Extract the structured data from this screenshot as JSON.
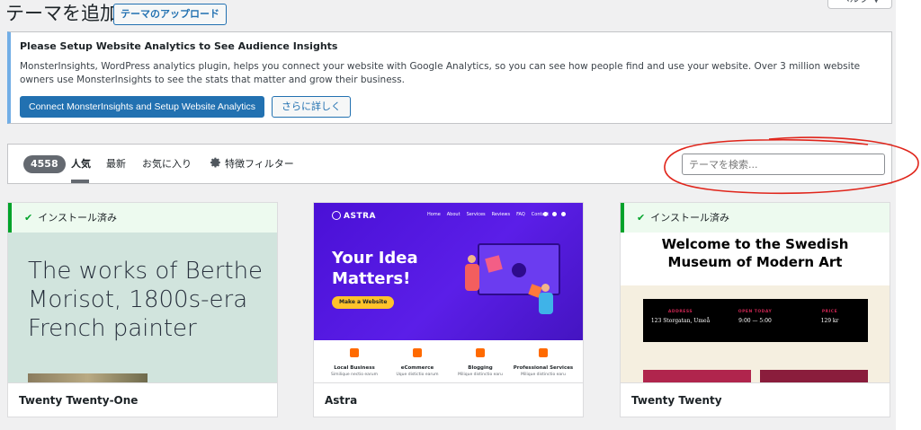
{
  "header": {
    "title": "テーマを追加",
    "upload_label": "テーマのアップロード",
    "help_label": "ヘルプ ▼"
  },
  "notice": {
    "title": "Please Setup Website Analytics to See Audience Insights",
    "body": "MonsterInsights, WordPress analytics plugin, helps you connect your website with Google Analytics, so you can see how people find and use your website. Over 3 million website owners use MonsterInsights to see the stats that matter and grow their business.",
    "primary_label": "Connect MonsterInsights and Setup Website Analytics",
    "secondary_label": "さらに詳しく"
  },
  "filter": {
    "count": "4558",
    "tabs": [
      "人気",
      "最新",
      "お気に入り"
    ],
    "feature_filter_label": "特徴フィルター",
    "search_placeholder": "テーマを検索..."
  },
  "themes": [
    {
      "name": "Twenty Twenty-One",
      "installed_label": "インストール済み",
      "preview_text": "The works of Berthe Morisot, 1800s-era French painter"
    },
    {
      "name": "Astra",
      "preview": {
        "logo": "ASTRA",
        "nav": [
          "Home",
          "About",
          "Services",
          "Reviews",
          "FAQ",
          "Contact"
        ],
        "headline_1": "Your Idea",
        "headline_2": "Matters!",
        "cta": "Make a Website",
        "services": [
          {
            "label": "Local Business",
            "sub": "Similique nectio earum"
          },
          {
            "label": "eCommerce",
            "sub": "Uque distictio earum"
          },
          {
            "label": "Blogging",
            "sub": "Milique distinctio earu"
          },
          {
            "label": "Professional Services",
            "sub": "Milique distinctio earu"
          }
        ]
      }
    },
    {
      "name": "Twenty Twenty",
      "installed_label": "インストール済み",
      "preview": {
        "headline_1": "Welcome to the Swedish",
        "headline_2": "Museum of Modern Art",
        "info": [
          {
            "k": "ADDRESS",
            "v": "123 Storgatan, Umeå"
          },
          {
            "k": "OPEN TODAY",
            "v": "9:00 — 5:00"
          },
          {
            "k": "PRICE",
            "v": "129 kr"
          }
        ]
      }
    }
  ],
  "colors": {
    "accent": "#2271b1",
    "installed_green": "#00a32a",
    "annotation_red": "#e0251b"
  }
}
